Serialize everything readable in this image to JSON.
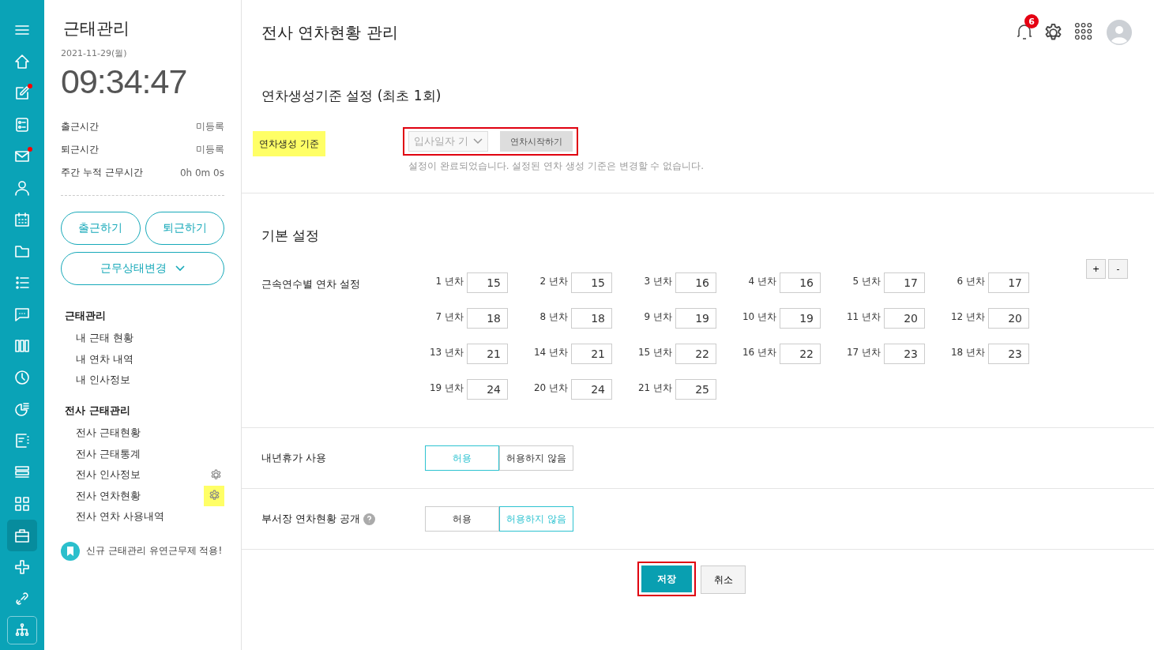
{
  "rail": {
    "items": [
      {
        "kind": "menu",
        "dot": false,
        "selected": false
      },
      {
        "kind": "home",
        "dot": false,
        "selected": false
      },
      {
        "kind": "edit",
        "dot": true,
        "selected": false
      },
      {
        "kind": "checklist",
        "dot": false,
        "selected": false
      },
      {
        "kind": "mail",
        "dot": true,
        "selected": false
      },
      {
        "kind": "person",
        "dot": false,
        "selected": false
      },
      {
        "kind": "calendar",
        "dot": false,
        "selected": false
      },
      {
        "kind": "folder",
        "dot": false,
        "selected": false
      },
      {
        "kind": "list",
        "dot": false,
        "selected": false
      },
      {
        "kind": "chat",
        "dot": false,
        "selected": false
      },
      {
        "kind": "columns",
        "dot": false,
        "selected": false
      },
      {
        "kind": "clock",
        "dot": false,
        "selected": false
      },
      {
        "kind": "chart",
        "dot": false,
        "selected": false
      },
      {
        "kind": "memo",
        "dot": false,
        "selected": false
      },
      {
        "kind": "rows",
        "dot": false,
        "selected": false
      },
      {
        "kind": "grid",
        "dot": false,
        "selected": false
      },
      {
        "kind": "briefcase",
        "dot": false,
        "selected": true
      },
      {
        "kind": "cross",
        "dot": false,
        "selected": false
      },
      {
        "kind": "link",
        "dot": false,
        "selected": false
      },
      {
        "kind": "org",
        "dot": false,
        "selected": false
      }
    ]
  },
  "sidebar": {
    "title": "근태관리",
    "date": "2021-11-29(월)",
    "clock": "09:34:47",
    "stats": [
      {
        "label": "출근시간",
        "value": "미등록"
      },
      {
        "label": "퇴근시간",
        "value": "미등록"
      },
      {
        "label": "주간 누적 근무시간",
        "value": "0h 0m 0s"
      }
    ],
    "buttons": [
      "출근하기",
      "퇴근하기"
    ],
    "status_button": "근무상태변경",
    "groups": [
      {
        "title": "근태관리",
        "items": [
          {
            "label": "내 근태 현황",
            "settings": false
          },
          {
            "label": "내 연차 내역",
            "settings": false
          },
          {
            "label": "내 인사정보",
            "settings": false
          }
        ]
      },
      {
        "title": "전사 근태관리",
        "items": [
          {
            "label": "전사 근태현황",
            "settings": false
          },
          {
            "label": "전사 근태통계",
            "settings": false
          },
          {
            "label": "전사 인사정보",
            "settings": true,
            "highlighted": false
          },
          {
            "label": "전사 연차현황",
            "settings": true,
            "highlighted": true
          },
          {
            "label": "전사 연차 사용내역",
            "settings": false
          }
        ]
      }
    ],
    "notice": "신규 근태관리 유연근무제 적용!"
  },
  "header": {
    "title": "전사 연차현황 관리",
    "notification_count": "6"
  },
  "criteria": {
    "heading": "연차생성기준 설정 (최초 1회)",
    "label": "연차생성 기준",
    "label_highlighted": true,
    "select": "입사일자 기",
    "button": "연차시작하기",
    "outlined": true,
    "help": "설정이 완료되었습니다. 설정된 연차 생성 기준은 변경할 수 없습니다."
  },
  "basic": {
    "heading": "기본 설정",
    "label": "근속연수별 연차 설정",
    "years": [
      {
        "label": "1 년차",
        "value": "15"
      },
      {
        "label": "2 년차",
        "value": "15"
      },
      {
        "label": "3 년차",
        "value": "16"
      },
      {
        "label": "4 년차",
        "value": "16"
      },
      {
        "label": "5 년차",
        "value": "17"
      },
      {
        "label": "6 년차",
        "value": "17"
      },
      {
        "label": "7 년차",
        "value": "18"
      },
      {
        "label": "8 년차",
        "value": "18"
      },
      {
        "label": "9 년차",
        "value": "19"
      },
      {
        "label": "10 년차",
        "value": "19"
      },
      {
        "label": "11 년차",
        "value": "20"
      },
      {
        "label": "12 년차",
        "value": "20"
      },
      {
        "label": "13 년차",
        "value": "21"
      },
      {
        "label": "14 년차",
        "value": "21"
      },
      {
        "label": "15 년차",
        "value": "22"
      },
      {
        "label": "16 년차",
        "value": "22"
      },
      {
        "label": "17 년차",
        "value": "23"
      },
      {
        "label": "18 년차",
        "value": "23"
      },
      {
        "label": "19 년차",
        "value": "24"
      },
      {
        "label": "20 년차",
        "value": "24"
      },
      {
        "label": "21 년차",
        "value": "25"
      }
    ],
    "add": "+",
    "remove": "-"
  },
  "options": [
    {
      "label": "내년휴가 사용",
      "help": false,
      "choices": [
        {
          "label": "허용",
          "selected": true
        },
        {
          "label": "허용하지 않음",
          "selected": false
        }
      ]
    },
    {
      "label": "부서장 연차현황 공개",
      "help": true,
      "choices": [
        {
          "label": "허용",
          "selected": false
        },
        {
          "label": "허용하지 않음",
          "selected": true
        }
      ]
    }
  ],
  "actions": {
    "save": "저장",
    "save_outlined": true,
    "cancel": "취소"
  }
}
